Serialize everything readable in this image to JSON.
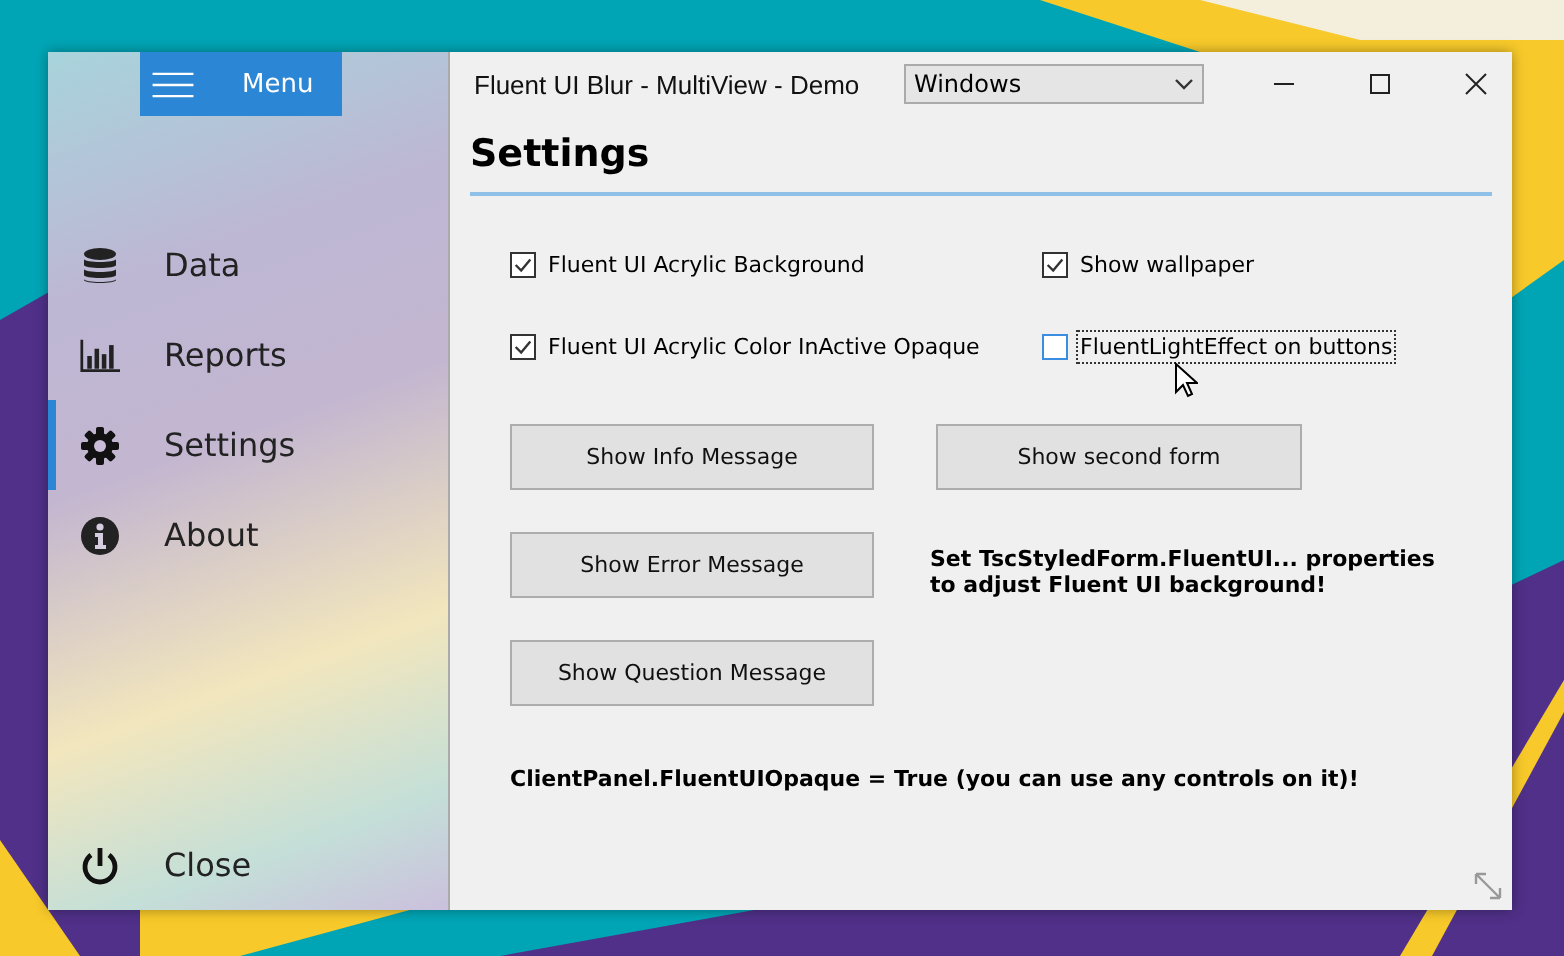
{
  "window": {
    "title": "Fluent UI Blur - MultiView - Demo",
    "style_select": {
      "value": "Windows"
    }
  },
  "menu_button": {
    "label": "Menu"
  },
  "sidebar": {
    "items": [
      {
        "label": "Data",
        "selected": false
      },
      {
        "label": "Reports",
        "selected": false
      },
      {
        "label": "Settings",
        "selected": true
      },
      {
        "label": "About",
        "selected": false
      }
    ],
    "footer": {
      "label": "Close"
    }
  },
  "page": {
    "heading": "Settings",
    "checkboxes": [
      {
        "label": "Fluent UI Acrylic Background",
        "checked": true,
        "focused": false
      },
      {
        "label": "Show wallpaper",
        "checked": true,
        "focused": false
      },
      {
        "label": "Fluent UI Acrylic Color InActive Opaque",
        "checked": true,
        "focused": false
      },
      {
        "label": "FluentLightEffect on buttons",
        "checked": false,
        "focused": true
      }
    ],
    "actions": [
      {
        "kind": "button",
        "label": "Show Info Message"
      },
      {
        "kind": "button",
        "label": "Show second form"
      },
      {
        "kind": "button",
        "label": "Show Error Message"
      },
      {
        "kind": "note",
        "label": "Set TscStyledForm.FluentUI... properties to adjust Fluent UI background!"
      },
      {
        "kind": "button",
        "label": "Show Question Message"
      }
    ],
    "footer_note": "ClientPanel.FluentUIOpaque = True (you can use any controls on it)!"
  }
}
